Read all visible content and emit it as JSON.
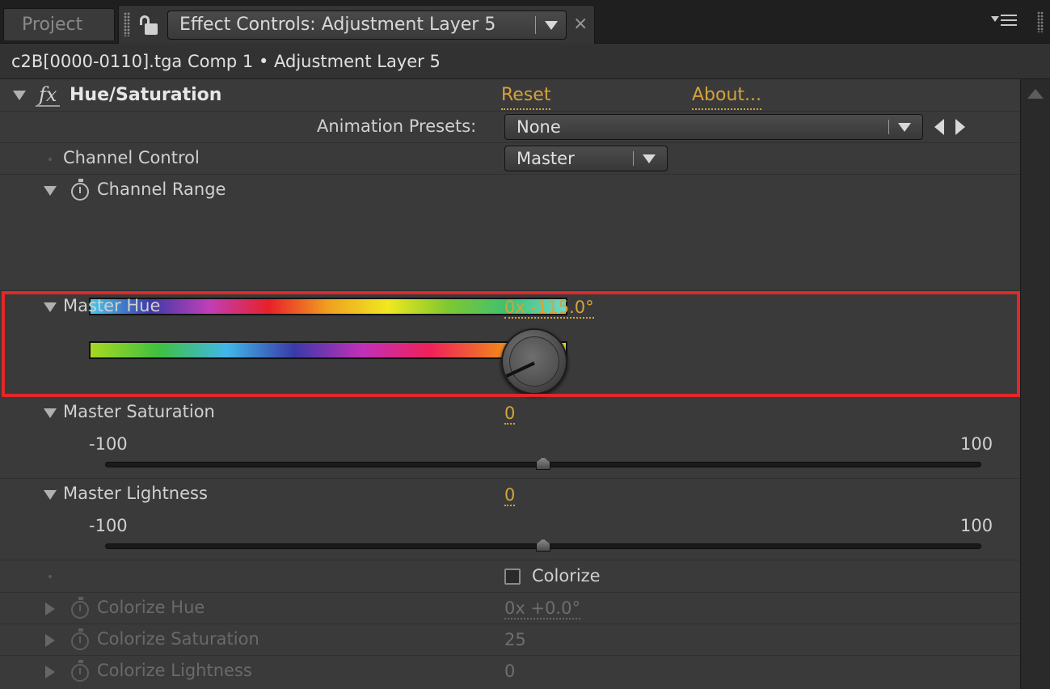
{
  "tabs": {
    "project_label": "Project",
    "effect_controls_label": "Effect Controls: Adjustment Layer 5",
    "close_glyph": "×"
  },
  "breadcrumb": "c2B[0000-0110].tga Comp 1 • Adjustment Layer 5",
  "effect": {
    "fx_glyph": "fx",
    "name": "Hue/Saturation",
    "reset_label": "Reset",
    "about_label": "About..."
  },
  "animation_presets": {
    "label": "Animation Presets:",
    "value": "None"
  },
  "channel_control": {
    "label": "Channel Control",
    "value": "Master"
  },
  "channel_range": {
    "label": "Channel Range"
  },
  "master_hue": {
    "label": "Master Hue",
    "value": "0x -115.0°",
    "angle_degrees": -115.0
  },
  "master_saturation": {
    "label": "Master Saturation",
    "value": "0",
    "min_label": "-100",
    "max_label": "100",
    "slider_fraction": 0.5
  },
  "master_lightness": {
    "label": "Master Lightness",
    "value": "0",
    "min_label": "-100",
    "max_label": "100",
    "slider_fraction": 0.5
  },
  "colorize": {
    "label": "Colorize",
    "checked": false
  },
  "colorize_hue": {
    "label": "Colorize Hue",
    "value": "0x +0.0°"
  },
  "colorize_saturation": {
    "label": "Colorize Saturation",
    "value": "25"
  },
  "colorize_lightness": {
    "label": "Colorize Lightness",
    "value": "0"
  },
  "colors": {
    "accent_value": "#d5a33a",
    "highlight_border": "#e0282a",
    "panel_bg": "#3a3a3a"
  }
}
